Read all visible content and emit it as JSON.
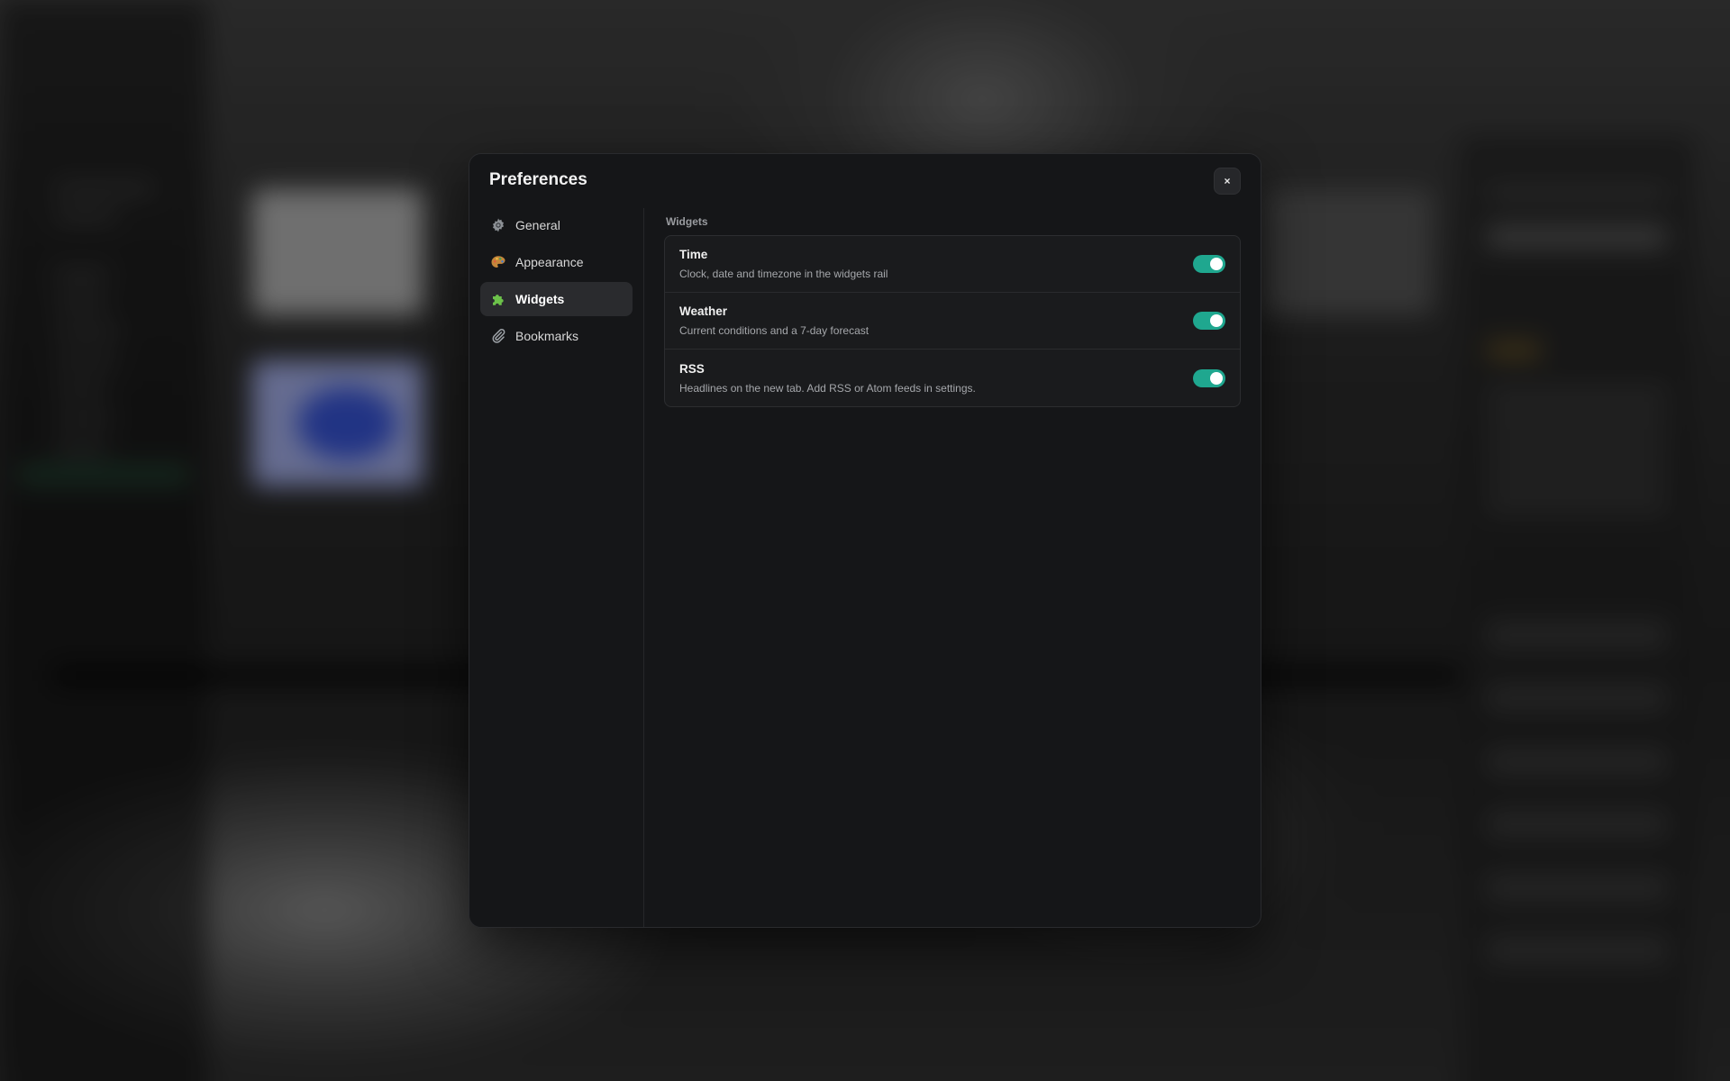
{
  "modal": {
    "title": "Preferences",
    "close_label": "×"
  },
  "nav": {
    "items": [
      {
        "label": "General",
        "icon": "gear-icon",
        "active": false
      },
      {
        "label": "Appearance",
        "icon": "palette-icon",
        "active": false
      },
      {
        "label": "Widgets",
        "icon": "puzzle-icon",
        "active": true
      },
      {
        "label": "Bookmarks",
        "icon": "paperclip-icon",
        "active": false
      }
    ]
  },
  "widgets": {
    "section_label": "Widgets",
    "items": [
      {
        "title": "Time",
        "description": "Clock, date and timezone in the widgets rail",
        "enabled": true
      },
      {
        "title": "Weather",
        "description": "Current conditions and a 7-day forecast",
        "enabled": true
      },
      {
        "title": "RSS",
        "description": "Headlines on the new tab. Add RSS or Atom feeds in settings.",
        "enabled": true
      }
    ]
  },
  "colors": {
    "toggle_on": "#1fa78f",
    "modal_bg": "#151618",
    "active_nav_bg": "#2a2b2e"
  }
}
